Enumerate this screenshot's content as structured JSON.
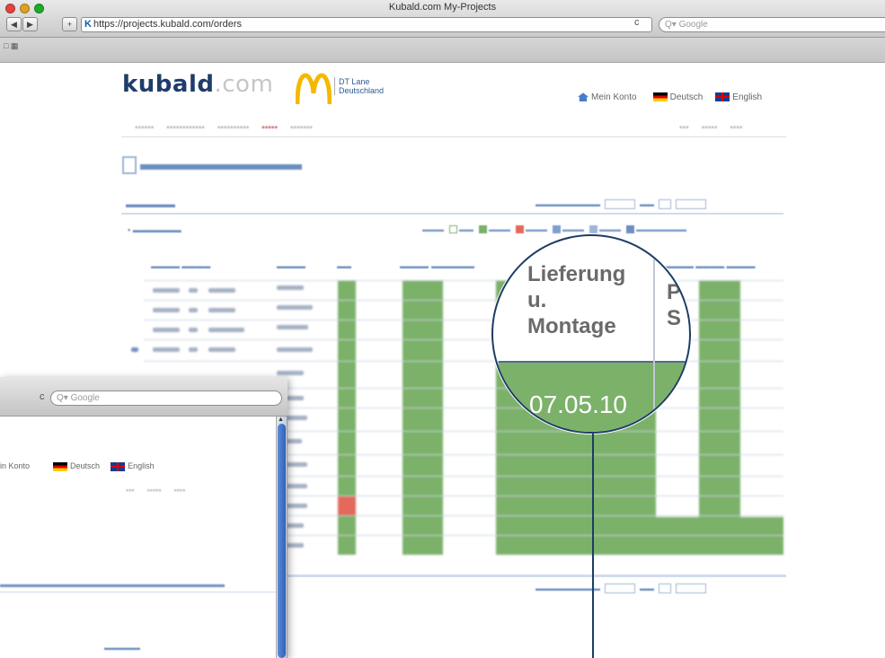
{
  "browser": {
    "window_title": "Kubald.com My-Projects",
    "url_icon": "K",
    "url": "https://projects.kubald.com/orders",
    "reload_glyph": "c",
    "search_placeholder": "Google",
    "search_prefix": "Q▾",
    "back_glyph": "◀",
    "forward_glyph": "▶",
    "add_glyph": "+",
    "bookmarks_glyph": "□ ▦"
  },
  "site": {
    "logo_main": "kubald",
    "logo_suffix": ".com",
    "partner_line1": "DT Lane",
    "partner_line2": "Deutschland",
    "my_account": "Mein Konto",
    "lang_de": "Deutsch",
    "lang_en": "English",
    "brand_color": "#1f3d6b",
    "arches_color": "#f5b800"
  },
  "magnifier": {
    "header_col1_line1": "Lieferung",
    "header_col1_line2": "u.",
    "header_col1_line3": "Montage",
    "header_col2_line1": "P",
    "header_col2_line2": "S",
    "date_value": "07.05.10",
    "cell_color": "#7cb16a"
  },
  "second_window": {
    "reload_glyph": "c",
    "search_placeholder": "Google",
    "search_prefix": "Q▾",
    "my_account_partial": "in Konto",
    "lang_de": "Deutsch",
    "lang_en": "English"
  }
}
